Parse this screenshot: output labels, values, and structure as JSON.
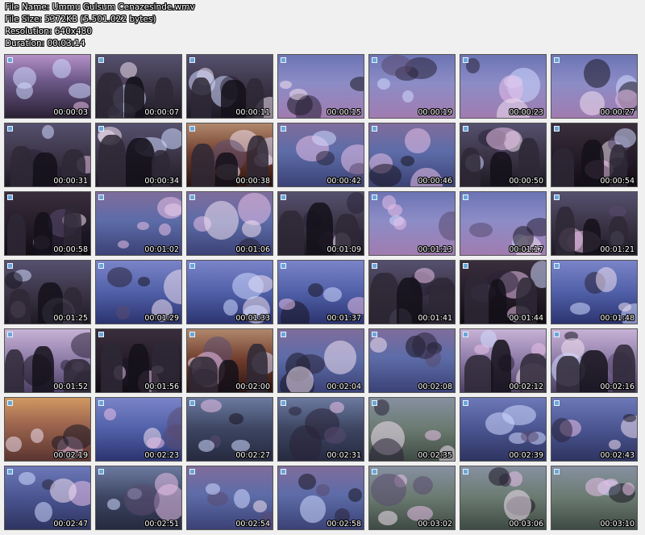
{
  "header": {
    "file_name": "File Name: Ummu Gulsum Cenazesinde.wmv",
    "file_size": "File Size: 5372KB (5.501.022 bytes)",
    "resolution": "Resolution: 640x480",
    "duration": "Duration: 00:03:14"
  },
  "thumbnails": [
    {
      "time": "00:00:03",
      "scene": "purple"
    },
    {
      "time": "00:00:07",
      "scene": "people"
    },
    {
      "time": "00:00:11",
      "scene": "people"
    },
    {
      "time": "00:00:15",
      "scene": "street"
    },
    {
      "time": "00:00:19",
      "scene": "street"
    },
    {
      "time": "00:00:23",
      "scene": "street"
    },
    {
      "time": "00:00:27",
      "scene": "street"
    },
    {
      "time": "00:00:31",
      "scene": "people"
    },
    {
      "time": "00:00:34",
      "scene": "people"
    },
    {
      "time": "00:00:38",
      "scene": "brown"
    },
    {
      "time": "00:00:42",
      "scene": "crowd"
    },
    {
      "time": "00:00:46",
      "scene": "crowd"
    },
    {
      "time": "00:00:50",
      "scene": "people"
    },
    {
      "time": "00:00:54",
      "scene": "dark"
    },
    {
      "time": "00:00:58",
      "scene": "dark"
    },
    {
      "time": "00:01:02",
      "scene": "crowd"
    },
    {
      "time": "00:01:06",
      "scene": "crowd"
    },
    {
      "time": "00:01:09",
      "scene": "people"
    },
    {
      "time": "00:01:13",
      "scene": "street"
    },
    {
      "time": "00:01:17",
      "scene": "street"
    },
    {
      "time": "00:01:21",
      "scene": "people"
    },
    {
      "time": "00:01:25",
      "scene": "people"
    },
    {
      "time": "00:01:29",
      "scene": "blue"
    },
    {
      "time": "00:01:33",
      "scene": "blue"
    },
    {
      "time": "00:01:37",
      "scene": "blue"
    },
    {
      "time": "00:01:41",
      "scene": "people"
    },
    {
      "time": "00:01:44",
      "scene": "dark"
    },
    {
      "time": "00:01:48",
      "scene": "blue"
    },
    {
      "time": "00:01:52",
      "scene": "bright"
    },
    {
      "time": "00:01:56",
      "scene": "dark"
    },
    {
      "time": "00:02:00",
      "scene": "brown"
    },
    {
      "time": "00:02:04",
      "scene": "crowd"
    },
    {
      "time": "00:02:08",
      "scene": "crowd"
    },
    {
      "time": "00:02:12",
      "scene": "bright"
    },
    {
      "time": "00:02:16",
      "scene": "bright"
    },
    {
      "time": "00:02:19",
      "scene": "ornate"
    },
    {
      "time": "00:02:23",
      "scene": "blue"
    },
    {
      "time": "00:02:27",
      "scene": "parade"
    },
    {
      "time": "00:02:31",
      "scene": "parade"
    },
    {
      "time": "00:02:35",
      "scene": "green"
    },
    {
      "time": "00:02:39",
      "scene": "mass"
    },
    {
      "time": "00:02:43",
      "scene": "mass"
    },
    {
      "time": "00:02:47",
      "scene": "mass"
    },
    {
      "time": "00:02:51",
      "scene": "parade"
    },
    {
      "time": "00:02:54",
      "scene": "crowd"
    },
    {
      "time": "00:02:58",
      "scene": "crowd"
    },
    {
      "time": "00:03:02",
      "scene": "green"
    },
    {
      "time": "00:03:06",
      "scene": "green"
    },
    {
      "time": "00:03:10",
      "scene": "green"
    }
  ],
  "icons": {
    "thumbnail_marker": "film-frame-icon"
  }
}
